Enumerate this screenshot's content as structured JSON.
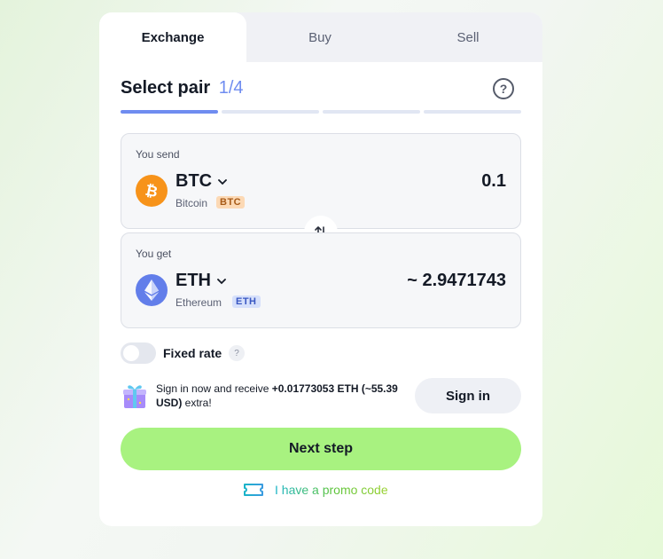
{
  "tabs": [
    {
      "label": "Exchange",
      "active": true
    },
    {
      "label": "Buy",
      "active": false
    },
    {
      "label": "Sell",
      "active": false
    }
  ],
  "step": {
    "title": "Select pair",
    "count": "1/4",
    "current": 1,
    "total": 4,
    "help_icon": "question-circle-icon"
  },
  "send": {
    "label": "You send",
    "ticker": "BTC",
    "name": "Bitcoin",
    "badge": "BTC",
    "amount": "0.1",
    "icon": "bitcoin-icon",
    "color": "#f7931a"
  },
  "swap": {
    "icon": "swap-arrows-icon"
  },
  "get": {
    "label": "You get",
    "ticker": "ETH",
    "name": "Ethereum",
    "badge": "ETH",
    "amount": "~ 2.9471743",
    "icon": "ethereum-icon",
    "color": "#627eea"
  },
  "fixed_rate": {
    "label": "Fixed rate",
    "enabled": false,
    "help": "?"
  },
  "promo": {
    "text_prefix": "Sign in now and receive ",
    "text_amount": "+0.01773053 ETH (~55.39 USD)",
    "text_suffix": " extra!",
    "icon": "gift-icon"
  },
  "signin": {
    "label": "Sign in"
  },
  "next": {
    "label": "Next step",
    "color": "#a8f280"
  },
  "promo_code": {
    "label": "I have a promo code",
    "icon": "ticket-icon"
  },
  "colors": {
    "accent": "#6f8cf0",
    "primary_button": "#a8f280"
  }
}
